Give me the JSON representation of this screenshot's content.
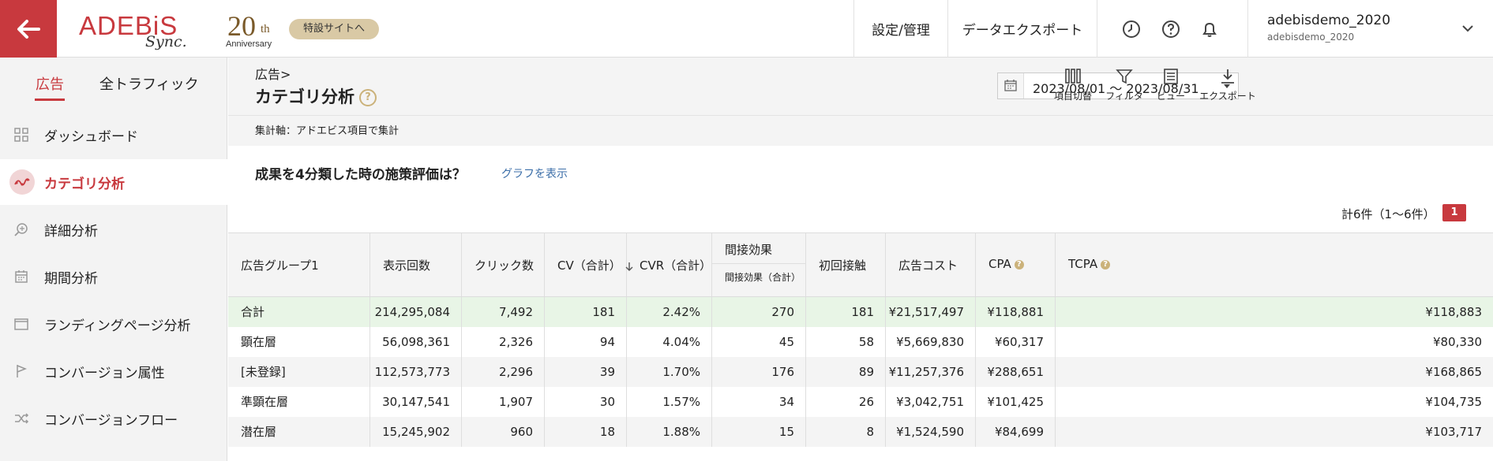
{
  "header": {
    "logo_main": "ADEBiS",
    "logo_sub": "Sync.",
    "anniversary_num": "20",
    "anniversary_th": "th",
    "anniversary_text": "Anniversary",
    "special_site": "特設サイトへ",
    "settings": "設定/管理",
    "data_export": "データエクスポート",
    "user_name": "adebisdemo_2020",
    "user_sub": "adebisdemo_2020"
  },
  "sidebar": {
    "tabs": [
      {
        "label": "広告"
      },
      {
        "label": "全トラフィック"
      }
    ],
    "items": [
      {
        "label": "ダッシュボード",
        "icon": "grid-icon"
      },
      {
        "label": "カテゴリ分析",
        "icon": "category-icon"
      },
      {
        "label": "詳細分析",
        "icon": "zoom-icon"
      },
      {
        "label": "期間分析",
        "icon": "calendar-icon"
      },
      {
        "label": "ランディングページ分析",
        "icon": "window-icon"
      },
      {
        "label": "コンバージョン属性",
        "icon": "flag-icon"
      },
      {
        "label": "コンバージョンフロー",
        "icon": "shuffle-icon"
      }
    ]
  },
  "main": {
    "breadcrumb": "広告>",
    "title": "カテゴリ分析",
    "help": "?",
    "date_range": "2023/08/01 ～ 2023/08/31",
    "tools": [
      {
        "label": "項目切替"
      },
      {
        "label": "フィルタ"
      },
      {
        "label": "ビュー"
      },
      {
        "label": "エクスポート"
      }
    ],
    "axis_line": "集計軸：アドエビス項目で集計",
    "question": "成果を4分類した時の施策評価は？",
    "graph_link": "グラフを表示",
    "count_text": "計6件（1〜6件）",
    "page_badge": "1"
  },
  "table": {
    "headers": {
      "group": "広告グループ1",
      "impressions": "表示回数",
      "clicks": "クリック数",
      "cv": "CV（合計）",
      "cvr": "CVR（合計）",
      "indirect": "間接効果",
      "indirect_sub": "間接効果（合計）",
      "first_contact": "初回接触",
      "ad_cost": "広告コスト",
      "cpa": "CPA",
      "tcpa": "TCPA"
    },
    "rows": [
      {
        "group": "合計",
        "impressions": "214,295,084",
        "clicks": "7,492",
        "cv": "181",
        "cvr": "2.42%",
        "indirect": "270",
        "first_contact": "181",
        "ad_cost": "¥21,517,497",
        "cpa": "¥118,881",
        "tcpa": "¥118,883"
      },
      {
        "group": "顕在層",
        "impressions": "56,098,361",
        "clicks": "2,326",
        "cv": "94",
        "cvr": "4.04%",
        "indirect": "45",
        "first_contact": "58",
        "ad_cost": "¥5,669,830",
        "cpa": "¥60,317",
        "tcpa": "¥80,330"
      },
      {
        "group": "[未登録]",
        "impressions": "112,573,773",
        "clicks": "2,296",
        "cv": "39",
        "cvr": "1.70%",
        "indirect": "176",
        "first_contact": "89",
        "ad_cost": "¥11,257,376",
        "cpa": "¥288,651",
        "tcpa": "¥168,865"
      },
      {
        "group": "準顕在層",
        "impressions": "30,147,541",
        "clicks": "1,907",
        "cv": "30",
        "cvr": "1.57%",
        "indirect": "34",
        "first_contact": "26",
        "ad_cost": "¥3,042,751",
        "cpa": "¥101,425",
        "tcpa": "¥104,735"
      },
      {
        "group": "潜在層",
        "impressions": "15,245,902",
        "clicks": "960",
        "cv": "18",
        "cvr": "1.88%",
        "indirect": "15",
        "first_contact": "8",
        "ad_cost": "¥1,524,590",
        "cpa": "¥84,699",
        "tcpa": "¥103,717"
      }
    ]
  }
}
